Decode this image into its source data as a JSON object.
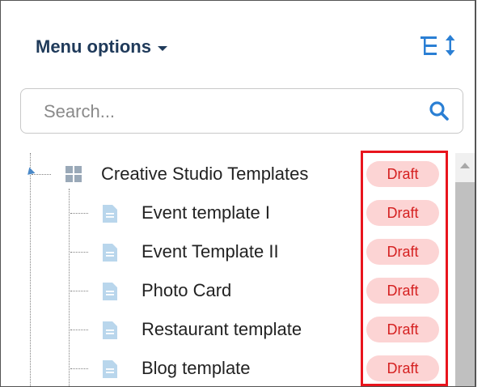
{
  "header": {
    "title": "Menu options"
  },
  "search": {
    "placeholder": "Search..."
  },
  "tree": {
    "root": {
      "label": "Creative Studio Templates",
      "status": "Draft",
      "icon": "grid-icon"
    },
    "children": [
      {
        "label": "Event template I",
        "status": "Draft",
        "icon": "document-icon"
      },
      {
        "label": "Event Template II",
        "status": "Draft",
        "icon": "document-icon"
      },
      {
        "label": "Photo Card",
        "status": "Draft",
        "icon": "document-icon"
      },
      {
        "label": "Restaurant template",
        "status": "Draft",
        "icon": "document-icon"
      },
      {
        "label": "Blog template",
        "status": "Draft",
        "icon": "document-icon"
      }
    ]
  },
  "colors": {
    "title": "#1f3a5a",
    "accent": "#2a7fd4",
    "badge_bg": "#fcd4d4",
    "badge_text": "#d52020",
    "highlight": "#e8141d",
    "doc_icon": "#b9d6ec"
  }
}
